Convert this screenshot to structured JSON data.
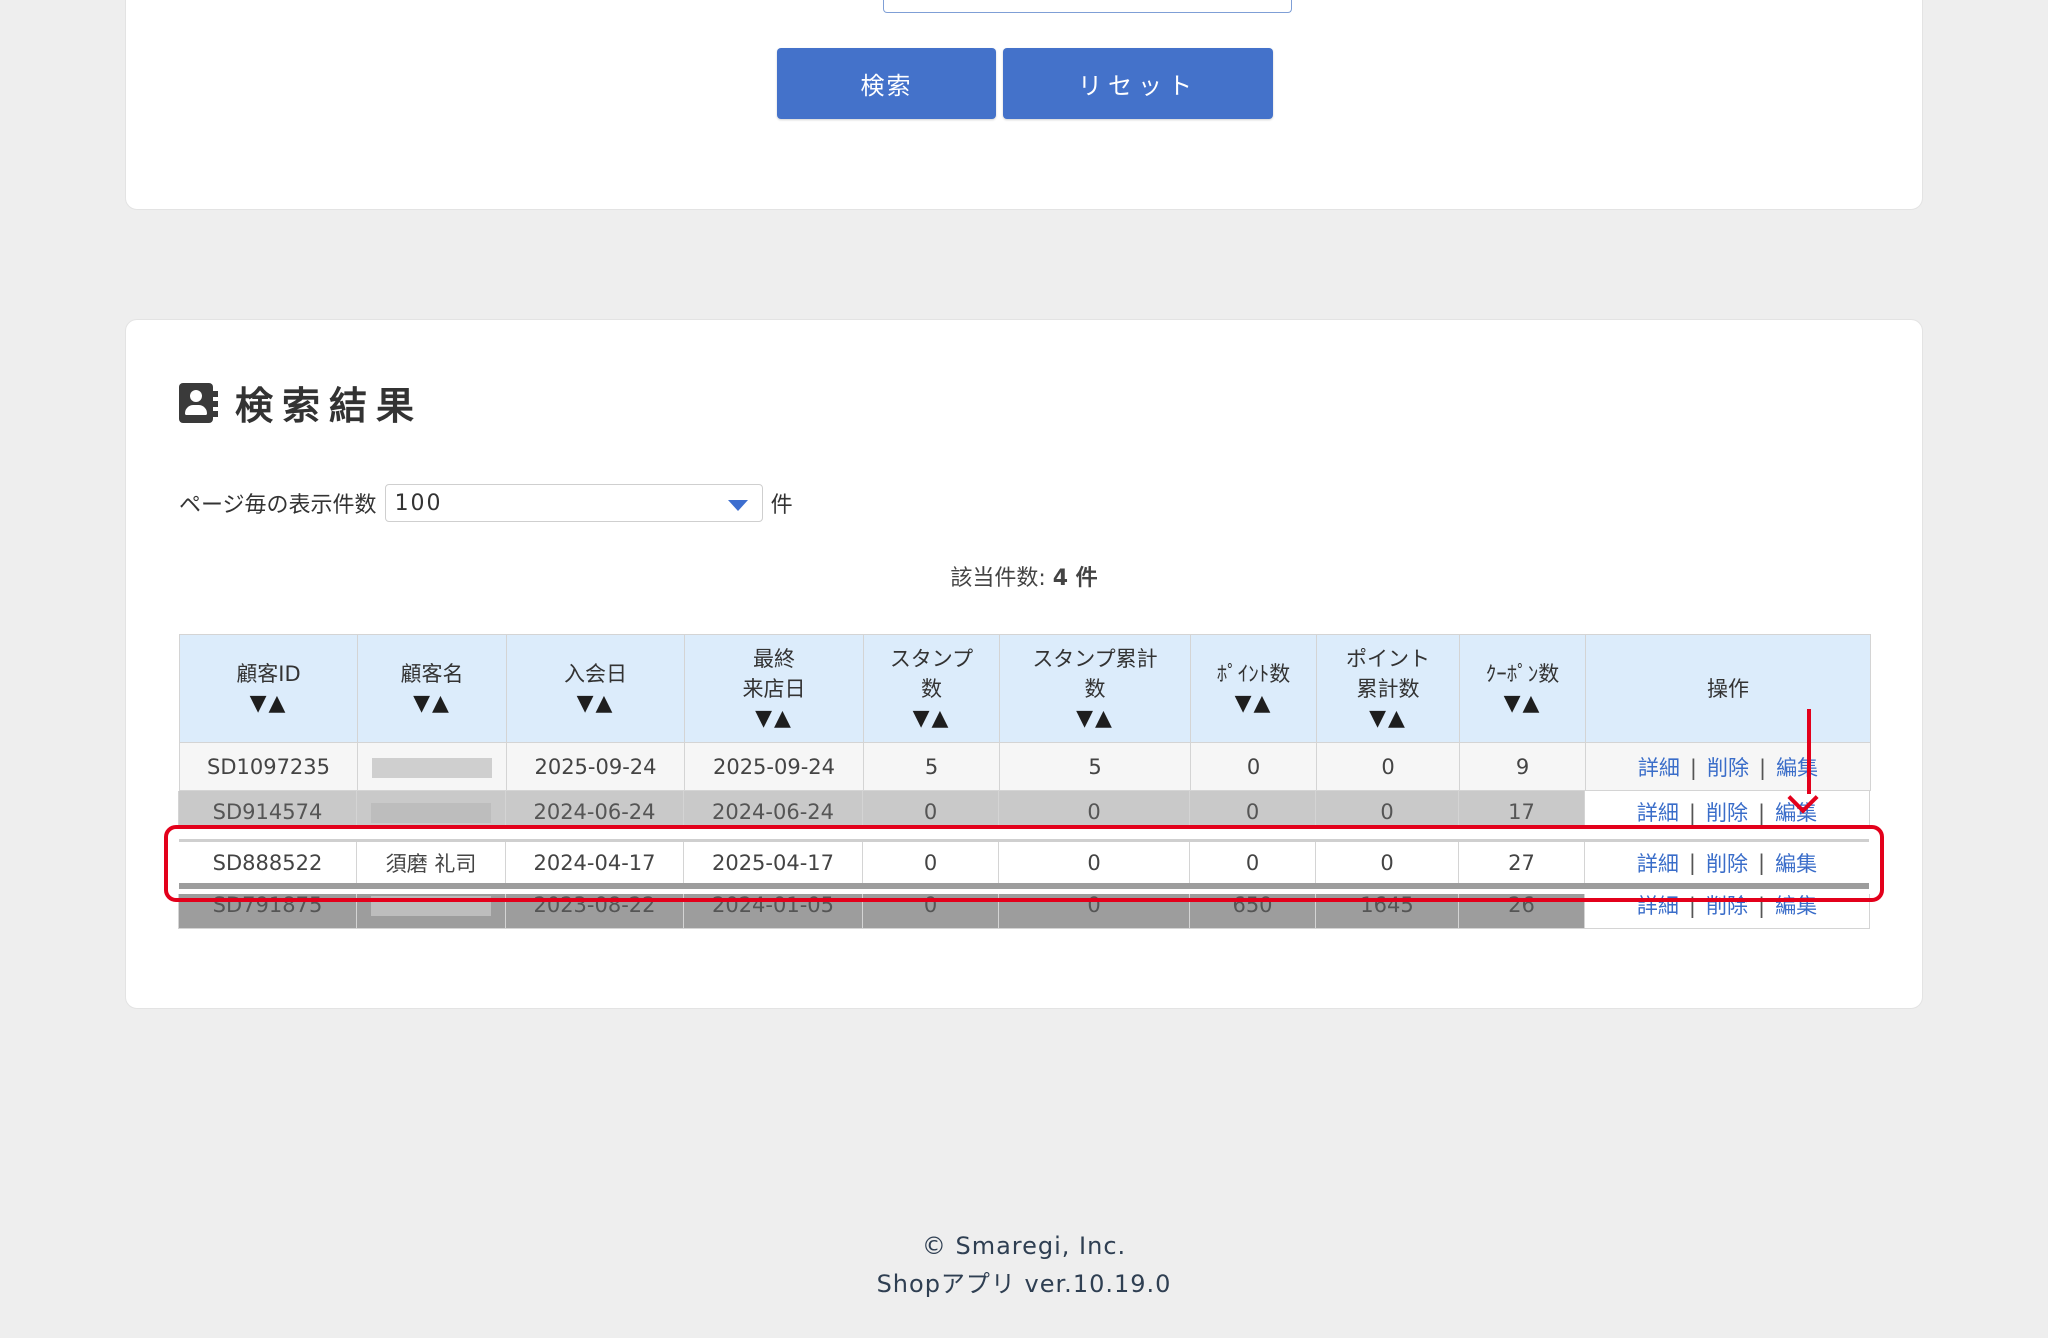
{
  "search": {
    "search_label": "検索",
    "reset_label": "リセット"
  },
  "results": {
    "title": "検索結果",
    "perpage_label": "ページ毎の表示件数",
    "perpage_value": "100",
    "perpage_unit": "件",
    "count_label": "該当件数: ",
    "count_value": "4 件",
    "columns": [
      {
        "label": "顧客ID",
        "sort": "▼▲"
      },
      {
        "label": "顧客名",
        "sort": "▼▲"
      },
      {
        "label": "入会日",
        "sort": "▼▲"
      },
      {
        "label": "最終\n来店日",
        "sort": "▼▲"
      },
      {
        "label": "スタンプ\n数",
        "sort": "▼▲"
      },
      {
        "label": "スタンプ累計\n数",
        "sort": "▼▲"
      },
      {
        "label": "ﾎﾟｲﾝﾄ数",
        "sort": "▼▲"
      },
      {
        "label": "ポイント\n累計数",
        "sort": "▼▲"
      },
      {
        "label": "ｸｰﾎﾟﾝ数",
        "sort": "▼▲"
      },
      {
        "label": "操作",
        "sort": ""
      }
    ],
    "rows": [
      {
        "id": "SD1097235",
        "name": "",
        "joined": "2025-09-24",
        "last_visit": "2025-09-24",
        "stamps": "5",
        "stamps_total": "5",
        "points": "0",
        "points_total": "0",
        "coupons": "9"
      },
      {
        "id": "SD914574",
        "name": "",
        "joined": "2024-06-24",
        "last_visit": "2024-06-24",
        "stamps": "0",
        "stamps_total": "0",
        "points": "0",
        "points_total": "0",
        "coupons": "17"
      },
      {
        "id": "SD888522",
        "name": "須磨 礼司",
        "joined": "2024-04-17",
        "last_visit": "2025-04-17",
        "stamps": "0",
        "stamps_total": "0",
        "points": "0",
        "points_total": "0",
        "coupons": "27"
      },
      {
        "id": "SD791875",
        "name": "",
        "joined": "2023-08-22",
        "last_visit": "2024-01-05",
        "stamps": "0",
        "stamps_total": "0",
        "points": "650",
        "points_total": "1645",
        "coupons": "26"
      }
    ],
    "actions": {
      "detail": "詳細",
      "delete": "削除",
      "edit": "編集",
      "sep": "|"
    }
  },
  "footer": {
    "copyright": "© Smaregi, Inc.",
    "version": "Shopアプリ ver.10.19.0"
  },
  "colors": {
    "accent": "#4472ca",
    "header_bg": "#dcecfb",
    "highlight": "#e3001b"
  }
}
